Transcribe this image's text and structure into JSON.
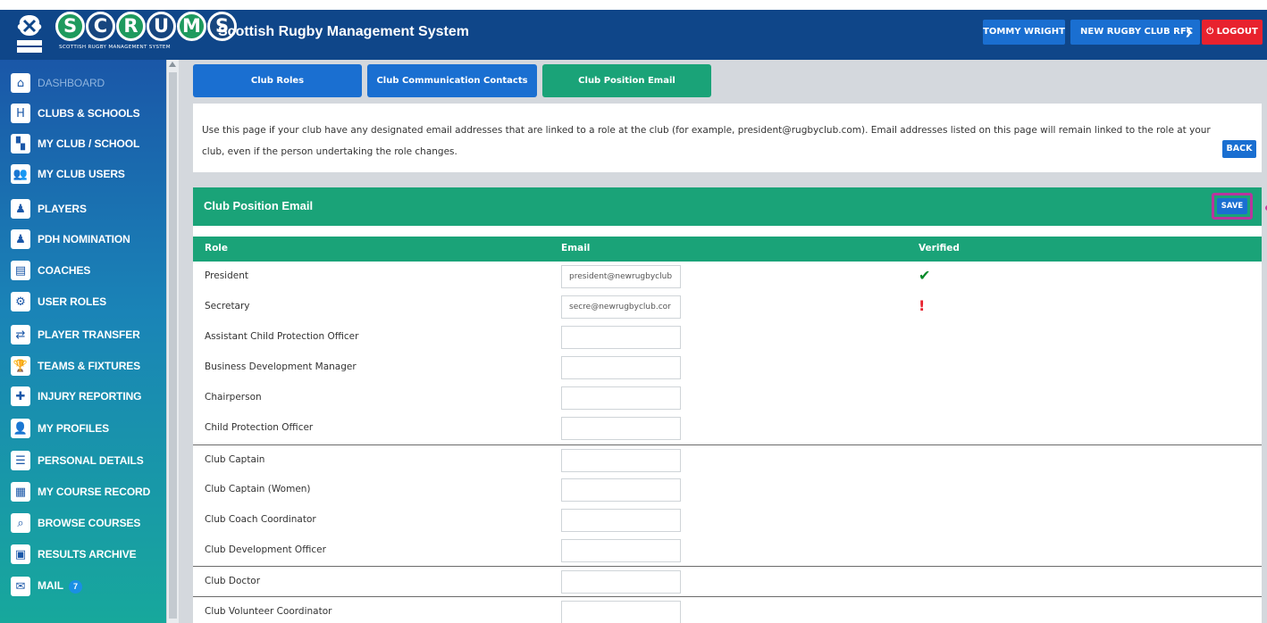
{
  "header": {
    "logo_letters": [
      "S",
      "C",
      "R",
      "U",
      "M",
      "S"
    ],
    "logo_subtitle": "SCOTTISH RUGBY MANAGEMENT SYSTEM",
    "crest_text": "SCOTTISH RUGBY",
    "title": "Scottish Rugby Management System",
    "user_label": "TOMMY WRIGHT",
    "club_label": "NEW RUGBY CLUB RFC",
    "logout_label": "LOGOUT"
  },
  "sidebar": {
    "items": [
      {
        "label": "DASHBOARD",
        "icon": "home-icon",
        "glyph": "⌂"
      },
      {
        "label": "CLUBS & SCHOOLS",
        "icon": "rugby-posts-icon",
        "glyph": "H"
      },
      {
        "label": "MY CLUB / SCHOOL",
        "icon": "club-icon",
        "glyph": "▚"
      },
      {
        "label": "MY CLUB USERS",
        "icon": "users-icon",
        "glyph": "👥"
      },
      {
        "label": "PLAYERS",
        "icon": "player-icon",
        "glyph": "♟"
      },
      {
        "label": "PDH NOMINATION",
        "icon": "nomination-icon",
        "glyph": "♟"
      },
      {
        "label": "COACHES",
        "icon": "clipboard-icon",
        "glyph": "▤"
      },
      {
        "label": "USER ROLES",
        "icon": "user-roles-icon",
        "glyph": "⚙"
      },
      {
        "label": "PLAYER TRANSFER",
        "icon": "transfer-icon",
        "glyph": "⇄"
      },
      {
        "label": "TEAMS & FIXTURES",
        "icon": "trophy-icon",
        "glyph": "🏆"
      },
      {
        "label": "INJURY REPORTING",
        "icon": "ambulance-icon",
        "glyph": "✚"
      },
      {
        "label": "MY PROFILES",
        "icon": "profile-icon",
        "glyph": "👤"
      },
      {
        "label": "PERSONAL DETAILS",
        "icon": "details-icon",
        "glyph": "☰"
      },
      {
        "label": "MY COURSE RECORD",
        "icon": "course-record-icon",
        "glyph": "▦"
      },
      {
        "label": "BROWSE COURSES",
        "icon": "browse-courses-icon",
        "glyph": "⌕"
      },
      {
        "label": "RESULTS ARCHIVE",
        "icon": "archive-icon",
        "glyph": "▣"
      },
      {
        "label": "MAIL",
        "icon": "mail-icon",
        "glyph": "✉",
        "badge": "7"
      }
    ]
  },
  "tabs": [
    {
      "label": "Club Roles"
    },
    {
      "label": "Club Communication Contacts"
    },
    {
      "label": "Club Position Email"
    }
  ],
  "info": {
    "text": "Use this page if your club have any designated email addresses that are linked to a role at the club (for example, president@rugbyclub.com). Email addresses listed on this page will remain linked to the role at your club, even if the person undertaking the role changes.",
    "back_label": "BACK"
  },
  "panel": {
    "title": "Club Position Email",
    "save_label": "SAVE",
    "columns": [
      "Role",
      "Email",
      "Verified"
    ],
    "rows": [
      {
        "role": "President",
        "email": "president@newrugbyclub",
        "verified": "ok"
      },
      {
        "role": "Secretary",
        "email": "secre@newrugbyclub.cor",
        "verified": "bad"
      },
      {
        "role": "Assistant Child Protection Officer",
        "email": "",
        "verified": ""
      },
      {
        "role": "Business Development Manager",
        "email": "",
        "verified": ""
      },
      {
        "role": "Chairperson",
        "email": "",
        "verified": ""
      },
      {
        "role": "Child Protection Officer",
        "email": "",
        "verified": ""
      },
      {
        "role": "Club Captain",
        "email": "",
        "verified": ""
      },
      {
        "role": "Club Captain (Women)",
        "email": "",
        "verified": ""
      },
      {
        "role": "Club Coach Coordinator",
        "email": "",
        "verified": ""
      },
      {
        "role": "Club Development Officer",
        "email": "",
        "verified": ""
      },
      {
        "role": "Club Doctor",
        "email": "",
        "verified": ""
      },
      {
        "role": "Club Volunteer Coordinator",
        "email": "",
        "verified": ""
      }
    ]
  },
  "colors": {
    "header_blue": "#0f4689",
    "button_blue": "#1a6fd1",
    "green": "#1aa378",
    "logout_red": "#e8222e",
    "verified_green": "#0a8a2a",
    "highlight_magenta": "#b9359e"
  }
}
